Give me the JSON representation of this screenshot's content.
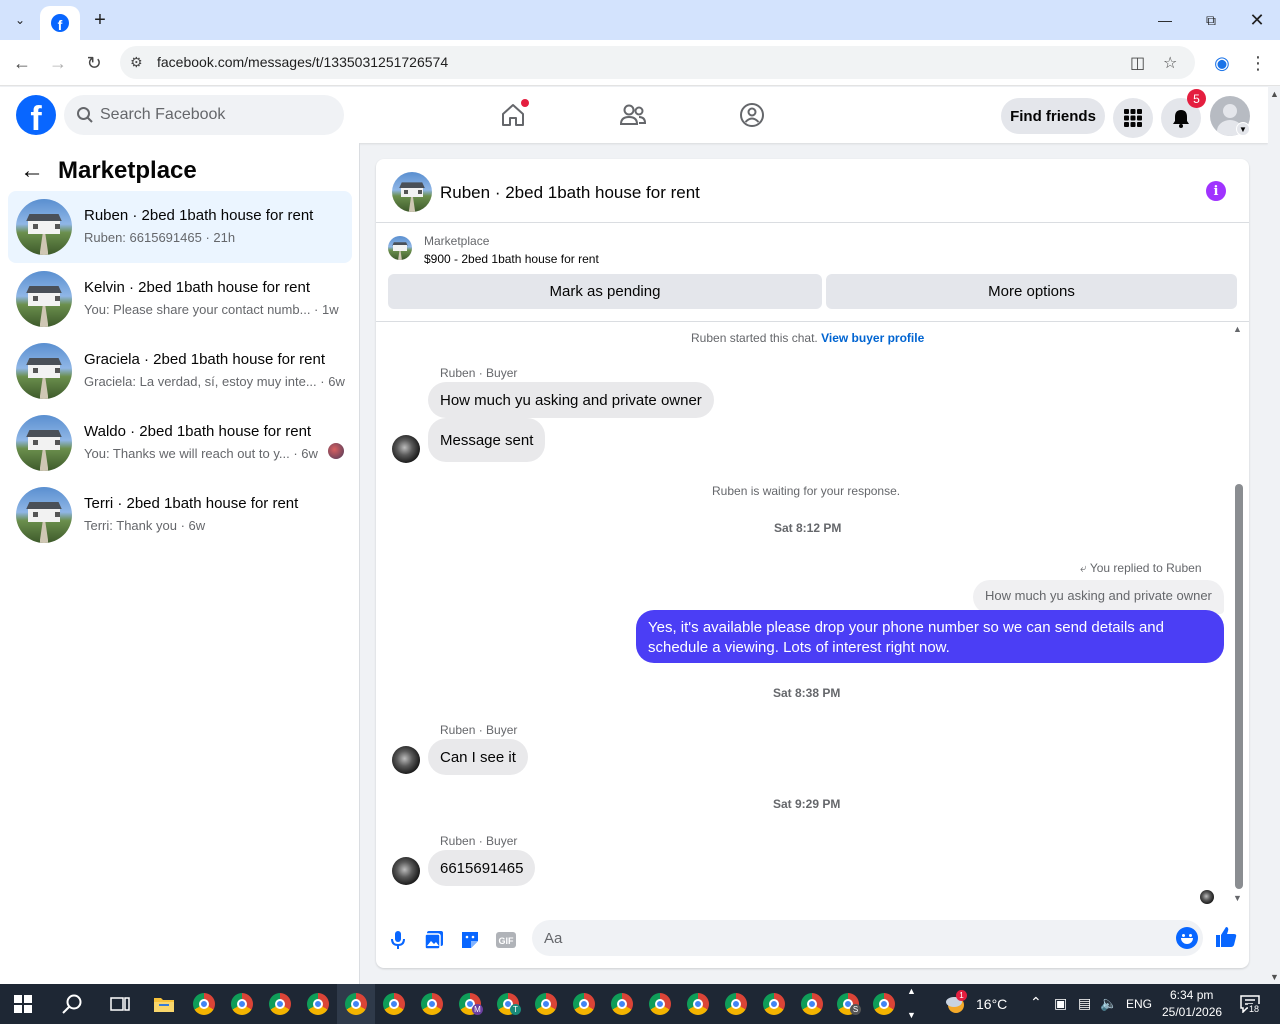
{
  "browser": {
    "url": "facebook.com/messages/t/1335031251726574",
    "new_tab_label": "+"
  },
  "fb": {
    "search_placeholder": "Search Facebook",
    "find_friends": "Find friends",
    "notification_count": "5",
    "colors": {
      "brand": "#0866ff",
      "badge": "#e41e3f",
      "outgoing_bubble": "#4b3ef5",
      "info": "#a033ff"
    }
  },
  "sidebar": {
    "title": "Marketplace",
    "conversations": [
      {
        "name": "Ruben · 2bed 1bath house for rent",
        "preview": "Ruben: 6615691465 · 21h"
      },
      {
        "name": "Kelvin · 2bed 1bath house for rent",
        "preview": "You: Please share your contact numb... · 1w"
      },
      {
        "name": "Graciela · 2bed 1bath house for rent",
        "preview": "Graciela: La verdad, sí, estoy muy inte... · 6w"
      },
      {
        "name": "Waldo · 2bed 1bath house for rent",
        "preview": "You: Thanks we will reach out to y... · 6w"
      },
      {
        "name": "Terri · 2bed 1bath house for rent",
        "preview": "Terri: Thank you · 6w"
      }
    ]
  },
  "chat": {
    "title": "Ruben · 2bed 1bath house for rent",
    "marketplace_label": "Marketplace",
    "listing": "$900 - 2bed 1bath house for rent",
    "mark_pending": "Mark as pending",
    "more_options": "More options",
    "started_text": "Ruben started this chat.",
    "view_profile": "View buyer profile",
    "sender_label": "Ruben · Buyer",
    "msg1": "How much yu asking and private owner",
    "msg2": "Message sent",
    "waiting": "Ruben is waiting for your response.",
    "time1": "Sat 8:12 PM",
    "reply_note": "You replied to Ruben",
    "reply_quote": "How much yu asking and private owner",
    "outgoing": "Yes, it's available please drop your phone number so we can send details and schedule a viewing. Lots of interest right now.",
    "time2": "Sat 8:38 PM",
    "msg3": "Can I see it",
    "time3": "Sat 9:29 PM",
    "msg4": "6615691465",
    "composer_placeholder": "Aa"
  },
  "taskbar": {
    "weather_temp": "16°C",
    "weather_alert": "1",
    "language": "ENG",
    "time": "6:34 pm",
    "date": "25/01/2026",
    "notifications": "18",
    "app_letters": [
      "M",
      "T",
      "S"
    ]
  }
}
